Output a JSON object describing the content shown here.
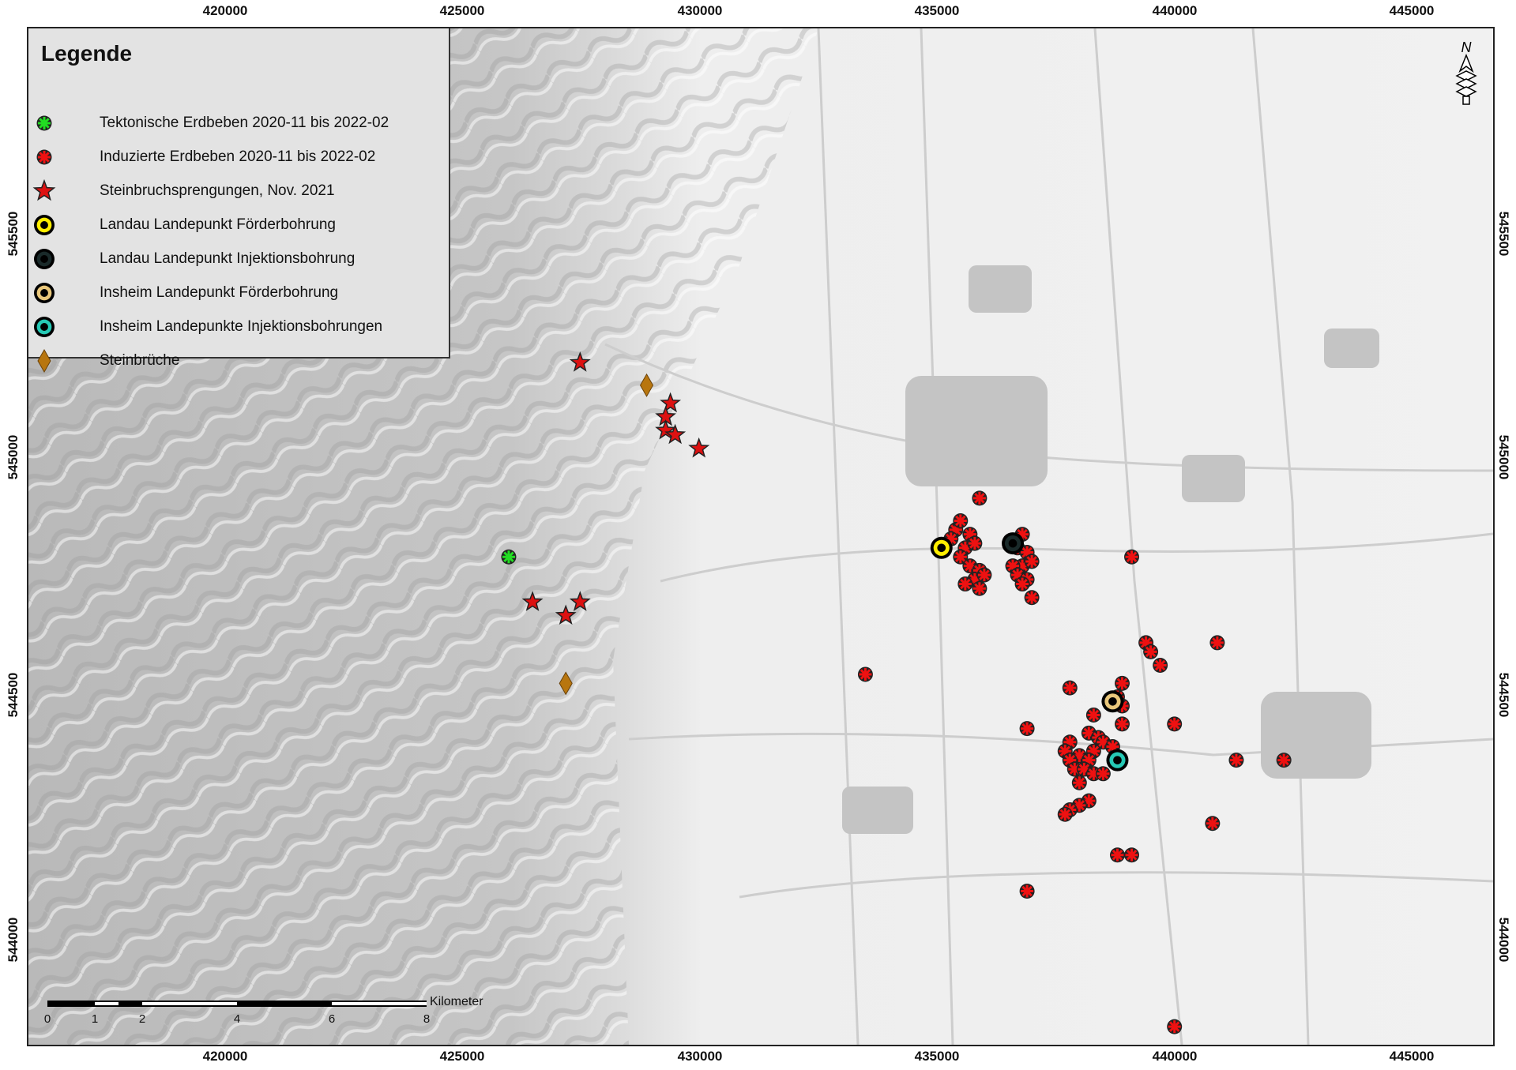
{
  "axes": {
    "x_ticks": [
      "420000",
      "425000",
      "430000",
      "435000",
      "440000",
      "445000"
    ],
    "y_ticks": [
      "545500",
      "545000",
      "544500",
      "544000"
    ]
  },
  "legend": {
    "title": "Legende",
    "items": [
      {
        "symbol": "green-asterisk",
        "label": "Tektonische Erdbeben 2020-11 bis 2022-02",
        "color": "#22dd22"
      },
      {
        "symbol": "red-asterisk",
        "label": "Induzierte Erdbeben 2020-11 bis 2022-02",
        "color": "#ee1111"
      },
      {
        "symbol": "red-star",
        "label": "Steinbruchsprengungen, Nov. 2021",
        "color": "#dd1111"
      },
      {
        "symbol": "yellow-circle",
        "label": "Landau Landepunkt Förderbohrung",
        "color": "#ffee00"
      },
      {
        "symbol": "dark-circle",
        "label": "Landau Landepunkt Injektionsbohrung",
        "color": "#1a2a2a"
      },
      {
        "symbol": "beige-circle",
        "label": "Insheim Landepunkt Förderbohrung",
        "color": "#e9c77b"
      },
      {
        "symbol": "teal-circle",
        "label": "Insheim Landepunkte Injektionsbohrungen",
        "color": "#26c9b5"
      },
      {
        "symbol": "brown-diamond",
        "label": "Steinbrüche",
        "color": "#b8760f"
      }
    ]
  },
  "scale_bar": {
    "labels": [
      "0",
      "1",
      "2",
      "4",
      "6",
      "8"
    ],
    "unit": "Kilometer"
  },
  "north_arrow": {
    "label": "N"
  },
  "chart_data": {
    "type": "scatter",
    "x_range": [
      415900,
      446700
    ],
    "y_range": [
      543800,
      546050
    ],
    "series": [
      {
        "name": "Tektonische Erdbeben 2020-11 bis 2022-02",
        "points": [
          [
            426000,
            544880
          ]
        ]
      },
      {
        "name": "Induzierte Erdbeben 2020-11 bis 2022-02",
        "points": [
          [
            435900,
            545010
          ],
          [
            435400,
            544940
          ],
          [
            435500,
            544960
          ],
          [
            435700,
            544930
          ],
          [
            435300,
            544920
          ],
          [
            435600,
            544900
          ],
          [
            435800,
            544910
          ],
          [
            435500,
            544880
          ],
          [
            435700,
            544860
          ],
          [
            435900,
            544850
          ],
          [
            435800,
            544830
          ],
          [
            436000,
            544840
          ],
          [
            435600,
            544820
          ],
          [
            435900,
            544810
          ],
          [
            436800,
            544930
          ],
          [
            436700,
            544900
          ],
          [
            436900,
            544890
          ],
          [
            436800,
            544860
          ],
          [
            436600,
            544860
          ],
          [
            437000,
            544870
          ],
          [
            436700,
            544840
          ],
          [
            436900,
            544830
          ],
          [
            436800,
            544820
          ],
          [
            437000,
            544790
          ],
          [
            439100,
            544880
          ],
          [
            439400,
            544690
          ],
          [
            439500,
            544670
          ],
          [
            439700,
            544640
          ],
          [
            440900,
            544690
          ],
          [
            433500,
            544620
          ],
          [
            437800,
            544590
          ],
          [
            438900,
            544600
          ],
          [
            438800,
            544570
          ],
          [
            438900,
            544550
          ],
          [
            438300,
            544530
          ],
          [
            438900,
            544510
          ],
          [
            436900,
            544500
          ],
          [
            440000,
            544510
          ],
          [
            438200,
            544490
          ],
          [
            438400,
            544480
          ],
          [
            438500,
            544470
          ],
          [
            437800,
            544470
          ],
          [
            438700,
            544460
          ],
          [
            438300,
            544450
          ],
          [
            437700,
            544450
          ],
          [
            438000,
            544440
          ],
          [
            438200,
            544430
          ],
          [
            437800,
            544430
          ],
          [
            441300,
            544430
          ],
          [
            442300,
            544430
          ],
          [
            437900,
            544410
          ],
          [
            438100,
            544410
          ],
          [
            438300,
            544400
          ],
          [
            438500,
            544400
          ],
          [
            438000,
            544380
          ],
          [
            438200,
            544340
          ],
          [
            438000,
            544330
          ],
          [
            437800,
            544320
          ],
          [
            437700,
            544310
          ],
          [
            440800,
            544290
          ],
          [
            438800,
            544220
          ],
          [
            439100,
            544220
          ],
          [
            436900,
            544140
          ],
          [
            440000,
            543840
          ]
        ]
      },
      {
        "name": "Steinbruchsprengungen, Nov. 2021",
        "points": [
          [
            427500,
            545310
          ],
          [
            429400,
            545220
          ],
          [
            429300,
            545190
          ],
          [
            429300,
            545160
          ],
          [
            429500,
            545150
          ],
          [
            430000,
            545120
          ],
          [
            426500,
            544780
          ],
          [
            427500,
            544780
          ],
          [
            427200,
            544750
          ]
        ]
      },
      {
        "name": "Landau Landepunkt Förderbohrung",
        "points": [
          [
            435100,
            544900
          ]
        ]
      },
      {
        "name": "Landau Landepunkt Injektionsbohrung",
        "points": [
          [
            436600,
            544910
          ]
        ]
      },
      {
        "name": "Insheim Landepunkt Förderbohrung",
        "points": [
          [
            438700,
            544560
          ]
        ]
      },
      {
        "name": "Insheim Landepunkte Injektionsbohrungen",
        "points": [
          [
            438800,
            544430
          ]
        ]
      },
      {
        "name": "Steinbrüche",
        "points": [
          [
            428900,
            545260
          ],
          [
            427200,
            544600
          ]
        ]
      }
    ]
  }
}
